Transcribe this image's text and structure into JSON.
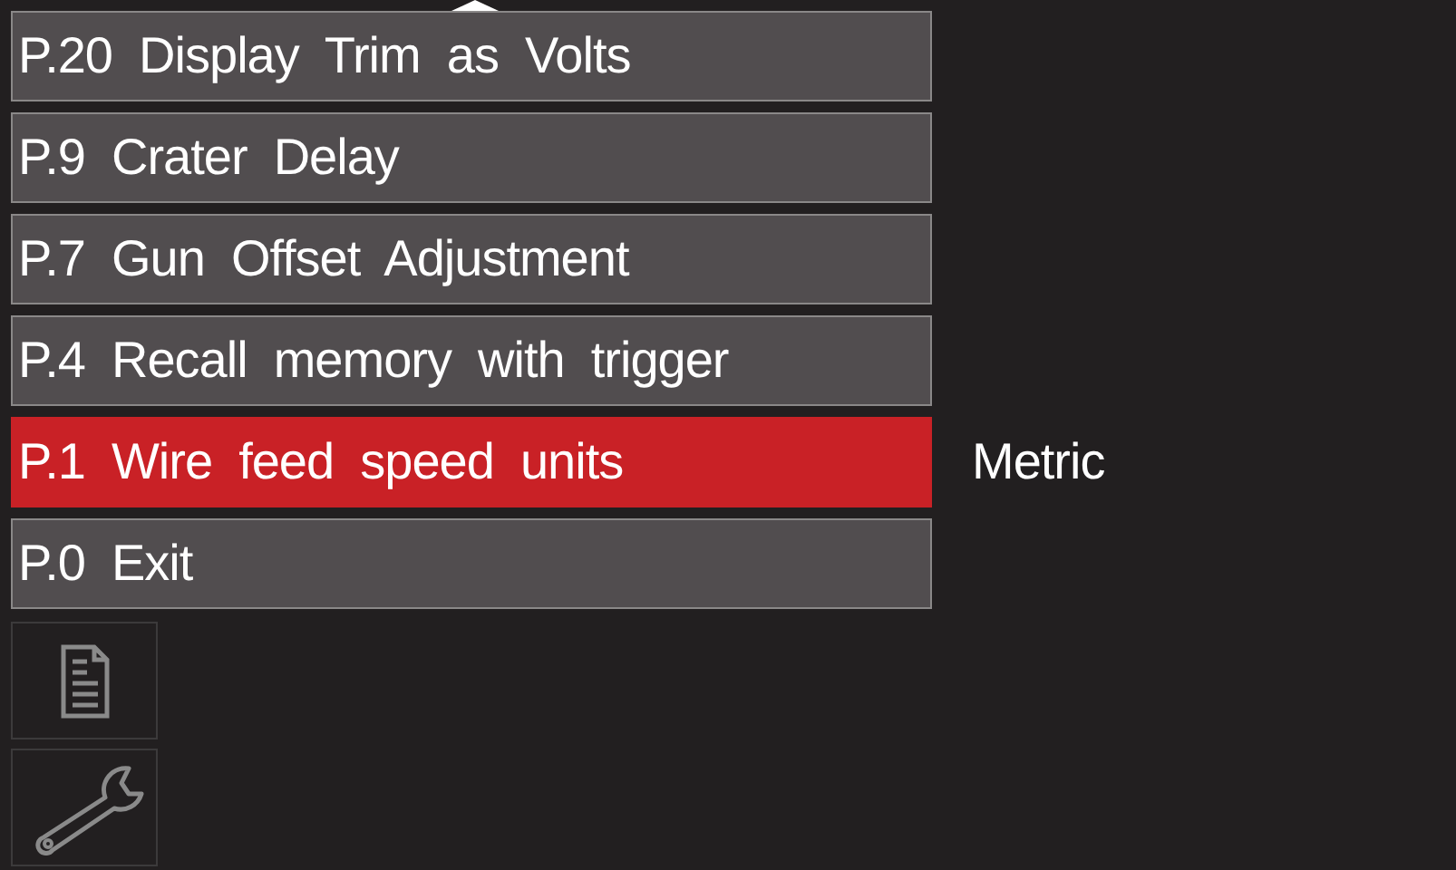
{
  "menu": [
    {
      "label": "P.20  Display  Trim  as  Volts",
      "selected": false
    },
    {
      "label": "P.9  Crater  Delay",
      "selected": false
    },
    {
      "label": "P.7  Gun  Offset  Adjustment",
      "selected": false
    },
    {
      "label": "P.4  Recall  memory  with  trigger",
      "selected": false
    },
    {
      "label": "P.1  Wire  feed  speed  units",
      "selected": true,
      "value": "Metric"
    },
    {
      "label": "P.0  Exit",
      "selected": false
    }
  ],
  "tools": [
    {
      "kind": "document"
    },
    {
      "kind": "wrench"
    }
  ]
}
